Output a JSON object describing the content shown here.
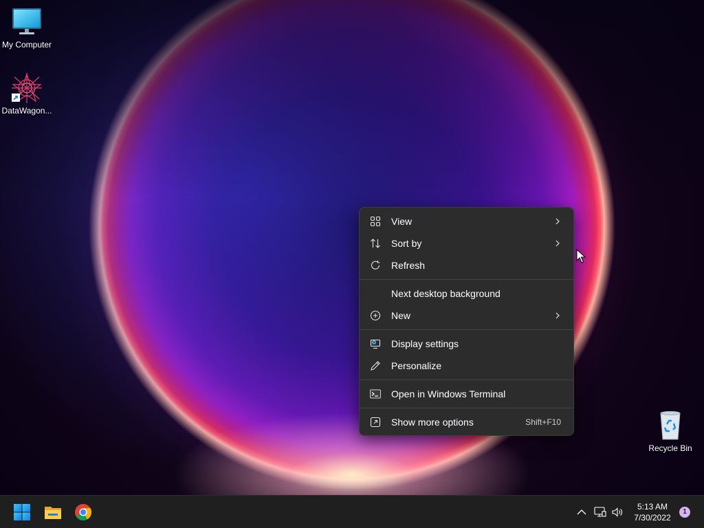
{
  "desktop": {
    "icons": [
      {
        "label": "My Computer",
        "icon": "computer-monitor-icon"
      },
      {
        "label": "DataWagon...",
        "icon": "datawagon-shortcut-icon"
      },
      {
        "label": "Recycle Bin",
        "icon": "recycle-bin-icon"
      }
    ]
  },
  "context_menu": {
    "items": [
      {
        "label": "View",
        "icon": "grid-icon",
        "submenu": true
      },
      {
        "label": "Sort by",
        "icon": "sort-arrows-icon",
        "submenu": true
      },
      {
        "label": "Refresh",
        "icon": "refresh-icon"
      },
      {
        "label": "Next desktop background"
      },
      {
        "label": "New",
        "icon": "plus-circle-icon",
        "submenu": true
      },
      {
        "label": "Display settings",
        "icon": "display-settings-icon"
      },
      {
        "label": "Personalize",
        "icon": "pen-icon"
      },
      {
        "label": "Open in Windows Terminal",
        "icon": "terminal-icon"
      },
      {
        "label": "Show more options",
        "icon": "show-more-icon",
        "shortcut": "Shift+F10"
      }
    ]
  },
  "taskbar": {
    "pinned": [
      "start-windows-icon",
      "file-explorer-icon",
      "chrome-icon"
    ],
    "tray": [
      "chevron-up-icon",
      "network-icon",
      "volume-icon"
    ],
    "time": "5:13 AM",
    "date": "7/30/2022",
    "notification_count": "1"
  },
  "colors": {
    "menu_bg": "#2c2c2c",
    "taskbar_bg": "#1f1f1f",
    "accent_blue": "#0078d4"
  }
}
